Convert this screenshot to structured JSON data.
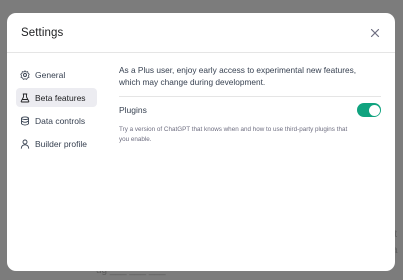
{
  "backdrop": {
    "fragment_1": "lt",
    "fragment_2": "a",
    "fragment_3": "ug ___  ___  ___ "
  },
  "modal": {
    "title": "Settings",
    "close_icon": "close-icon"
  },
  "sidebar": {
    "items": [
      {
        "label": "General",
        "icon": "gear-icon",
        "active": false
      },
      {
        "label": "Beta features",
        "icon": "flask-icon",
        "active": true
      },
      {
        "label": "Data controls",
        "icon": "database-icon",
        "active": false
      },
      {
        "label": "Builder profile",
        "icon": "person-icon",
        "active": false
      }
    ]
  },
  "content": {
    "description": "As a Plus user, enjoy early access to experimental new features, which may change during development.",
    "plugins": {
      "label": "Plugins",
      "enabled": true,
      "description": "Try a version of ChatGPT that knows when and how to use third-party plugins that you enable."
    }
  },
  "colors": {
    "accent": "#10a37f",
    "backdrop": "#7c7c7c",
    "active_nav": "#ececf1"
  }
}
